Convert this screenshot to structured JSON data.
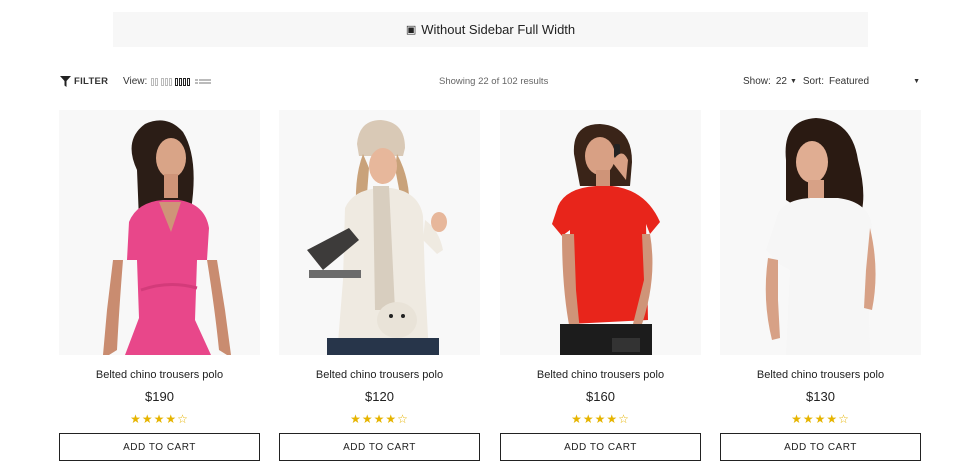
{
  "banner": {
    "icon": "square-icon",
    "text": "Without Sidebar Full Width"
  },
  "toolbar": {
    "filter_label": "FILTER",
    "view_label": "View:",
    "results_text": "Showing 22 of 102 results",
    "show_label": "Show:",
    "show_value": "22",
    "sort_label": "Sort:",
    "sort_value": "Featured"
  },
  "products": [
    {
      "title": "Belted chino trousers polo",
      "price": "$190",
      "rating": 4,
      "cart_label": "ADD TO CART"
    },
    {
      "title": "Belted chino trousers polo",
      "price": "$120",
      "rating": 4,
      "cart_label": "ADD TO CART"
    },
    {
      "title": "Belted chino trousers polo",
      "price": "$160",
      "rating": 4,
      "cart_label": "ADD TO CART"
    },
    {
      "title": "Belted chino trousers polo",
      "price": "$130",
      "rating": 4,
      "cart_label": "ADD TO CART"
    }
  ],
  "colors": {
    "star": "#e6b400",
    "dress_pink": "#e8478a",
    "top_red": "#e8251b",
    "banner_bg": "#f7f7f7"
  }
}
